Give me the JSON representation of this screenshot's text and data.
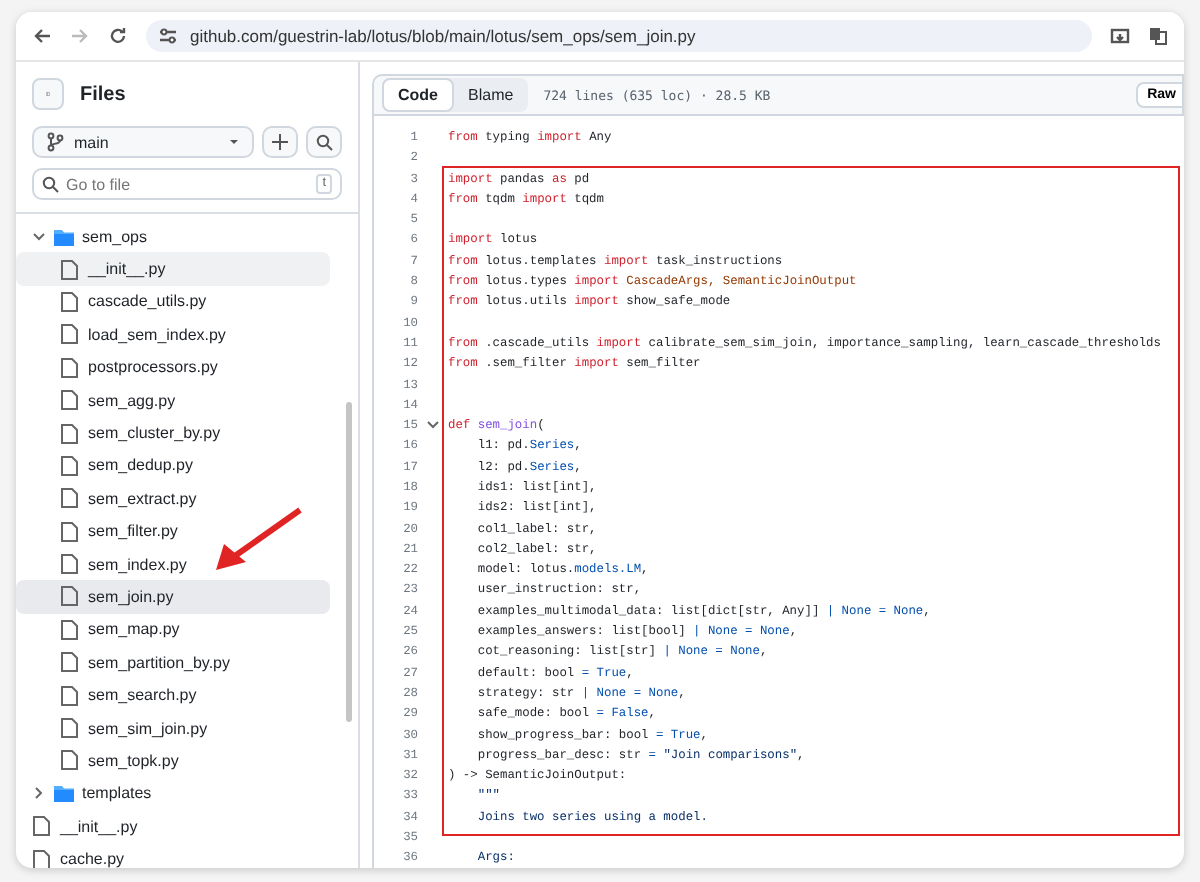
{
  "browser": {
    "url": "github.com/guestrin-lab/lotus/blob/main/lotus/sem_ops/sem_join.py"
  },
  "sidebar": {
    "title": "Files",
    "branch": "main",
    "search": {
      "placeholder": "Go to file",
      "shortcut": "t"
    },
    "tree": [
      {
        "name": "sem_ops",
        "kind": "folder",
        "expanded": true,
        "selected": false,
        "hovered": false,
        "children": [
          {
            "name": "__init__.py",
            "kind": "file",
            "selected": false,
            "hovered": true
          },
          {
            "name": "cascade_utils.py",
            "kind": "file",
            "selected": false,
            "hovered": false
          },
          {
            "name": "load_sem_index.py",
            "kind": "file",
            "selected": false,
            "hovered": false
          },
          {
            "name": "postprocessors.py",
            "kind": "file",
            "selected": false,
            "hovered": false
          },
          {
            "name": "sem_agg.py",
            "kind": "file",
            "selected": false,
            "hovered": false
          },
          {
            "name": "sem_cluster_by.py",
            "kind": "file",
            "selected": false,
            "hovered": false
          },
          {
            "name": "sem_dedup.py",
            "kind": "file",
            "selected": false,
            "hovered": false
          },
          {
            "name": "sem_extract.py",
            "kind": "file",
            "selected": false,
            "hovered": false
          },
          {
            "name": "sem_filter.py",
            "kind": "file",
            "selected": false,
            "hovered": false
          },
          {
            "name": "sem_index.py",
            "kind": "file",
            "selected": false,
            "hovered": false
          },
          {
            "name": "sem_join.py",
            "kind": "file",
            "selected": true,
            "hovered": false
          },
          {
            "name": "sem_map.py",
            "kind": "file",
            "selected": false,
            "hovered": false
          },
          {
            "name": "sem_partition_by.py",
            "kind": "file",
            "selected": false,
            "hovered": false
          },
          {
            "name": "sem_search.py",
            "kind": "file",
            "selected": false,
            "hovered": false
          },
          {
            "name": "sem_sim_join.py",
            "kind": "file",
            "selected": false,
            "hovered": false
          },
          {
            "name": "sem_topk.py",
            "kind": "file",
            "selected": false,
            "hovered": false
          }
        ]
      },
      {
        "name": "templates",
        "kind": "folder",
        "expanded": false,
        "selected": false,
        "hovered": false
      },
      {
        "name": "__init__.py",
        "kind": "file",
        "selected": false,
        "hovered": false
      },
      {
        "name": "cache.py",
        "kind": "file",
        "selected": false,
        "hovered": false
      }
    ]
  },
  "code": {
    "tabs": [
      {
        "label": "Code",
        "selected": true
      },
      {
        "label": "Blame",
        "selected": false
      }
    ],
    "info": "724 lines (635 loc) · 28.5 KB",
    "raw_button": "Raw",
    "lines": [
      {
        "n": "1",
        "tokens": [
          {
            "kind": "kw",
            "text": "from"
          },
          {
            "kind": "tx",
            "text": " typing "
          },
          {
            "kind": "kw",
            "text": "import"
          },
          {
            "kind": "tx",
            "text": " Any"
          }
        ]
      },
      {
        "n": "2"
      },
      {
        "n": "3",
        "tokens": [
          {
            "kind": "kw",
            "text": "import"
          },
          {
            "kind": "tx",
            "text": " pandas "
          },
          {
            "kind": "kw",
            "text": "as"
          },
          {
            "kind": "tx",
            "text": " pd"
          }
        ]
      },
      {
        "n": "4",
        "tokens": [
          {
            "kind": "kw",
            "text": "from"
          },
          {
            "kind": "tx",
            "text": " tqdm "
          },
          {
            "kind": "kw",
            "text": "import"
          },
          {
            "kind": "tx",
            "text": " tqdm"
          }
        ]
      },
      {
        "n": "5"
      },
      {
        "n": "6",
        "tokens": [
          {
            "kind": "kw",
            "text": "import"
          },
          {
            "kind": "tx",
            "text": " lotus"
          }
        ]
      },
      {
        "n": "7",
        "tokens": [
          {
            "kind": "kw",
            "text": "from"
          },
          {
            "kind": "tx",
            "text": " lotus.templates "
          },
          {
            "kind": "kw",
            "text": "import"
          },
          {
            "kind": "tx",
            "text": " task_instructions"
          }
        ]
      },
      {
        "n": "8",
        "tokens": [
          {
            "kind": "kw",
            "text": "from"
          },
          {
            "kind": "tx",
            "text": " lotus.types "
          },
          {
            "kind": "kw",
            "text": "import"
          },
          {
            "kind": "cls",
            "text": " CascadeArgs, SemanticJoinOutput"
          }
        ]
      },
      {
        "n": "9",
        "tokens": [
          {
            "kind": "kw",
            "text": "from"
          },
          {
            "kind": "tx",
            "text": " lotus.utils "
          },
          {
            "kind": "kw",
            "text": "import"
          },
          {
            "kind": "tx",
            "text": " show_safe_mode"
          }
        ]
      },
      {
        "n": "10"
      },
      {
        "n": "11",
        "tokens": [
          {
            "kind": "kw",
            "text": "from"
          },
          {
            "kind": "tx",
            "text": " .cascade_utils "
          },
          {
            "kind": "kw",
            "text": "import"
          },
          {
            "kind": "tx",
            "text": " calibrate_sem_sim_join, importance_sampling, learn_cascade_thresholds"
          }
        ]
      },
      {
        "n": "12",
        "tokens": [
          {
            "kind": "kw",
            "text": "from"
          },
          {
            "kind": "tx",
            "text": " .sem_filter "
          },
          {
            "kind": "kw",
            "text": "import"
          },
          {
            "kind": "tx",
            "text": " sem_filter"
          }
        ]
      },
      {
        "n": "13"
      },
      {
        "n": "14"
      },
      {
        "n": "15",
        "foldable": true,
        "tokens": [
          {
            "kind": "kw",
            "text": "def"
          },
          {
            "kind": "fn",
            "text": " sem_join"
          },
          {
            "kind": "tx",
            "text": "("
          }
        ]
      },
      {
        "n": "16",
        "tokens": [
          {
            "kind": "tx",
            "text": "    l1: pd."
          },
          {
            "kind": "bl",
            "text": "Series"
          },
          {
            "kind": "tx",
            "text": ","
          }
        ]
      },
      {
        "n": "17",
        "tokens": [
          {
            "kind": "tx",
            "text": "    l2: pd."
          },
          {
            "kind": "bl",
            "text": "Series"
          },
          {
            "kind": "tx",
            "text": ","
          }
        ]
      },
      {
        "n": "18",
        "tokens": [
          {
            "kind": "tx",
            "text": "    ids1: list[int],"
          }
        ]
      },
      {
        "n": "19",
        "tokens": [
          {
            "kind": "tx",
            "text": "    ids2: list[int],"
          }
        ]
      },
      {
        "n": "20",
        "tokens": [
          {
            "kind": "tx",
            "text": "    col1_label: str,"
          }
        ]
      },
      {
        "n": "21",
        "tokens": [
          {
            "kind": "tx",
            "text": "    col2_label: str,"
          }
        ]
      },
      {
        "n": "22",
        "tokens": [
          {
            "kind": "tx",
            "text": "    model: lotus."
          },
          {
            "kind": "bl",
            "text": "models.LM"
          },
          {
            "kind": "tx",
            "text": ","
          }
        ]
      },
      {
        "n": "23",
        "tokens": [
          {
            "kind": "tx",
            "text": "    user_instruction: str,"
          }
        ]
      },
      {
        "n": "24",
        "tokens": [
          {
            "kind": "tx",
            "text": "    examples_multimodal_data: list[dict[str, Any]] "
          },
          {
            "kind": "bl",
            "text": "| None = None"
          },
          {
            "kind": "tx",
            "text": ","
          }
        ]
      },
      {
        "n": "25",
        "tokens": [
          {
            "kind": "tx",
            "text": "    examples_answers: list[bool] "
          },
          {
            "kind": "bl",
            "text": "| None = None"
          },
          {
            "kind": "tx",
            "text": ","
          }
        ]
      },
      {
        "n": "26",
        "tokens": [
          {
            "kind": "tx",
            "text": "    cot_reasoning: list[str] "
          },
          {
            "kind": "bl",
            "text": "| None = None"
          },
          {
            "kind": "tx",
            "text": ","
          }
        ]
      },
      {
        "n": "27",
        "tokens": [
          {
            "kind": "tx",
            "text": "    default: bool "
          },
          {
            "kind": "bl",
            "text": "= True"
          },
          {
            "kind": "tx",
            "text": ","
          }
        ]
      },
      {
        "n": "28",
        "tokens": [
          {
            "kind": "tx",
            "text": "    strategy: str "
          },
          {
            "kind": "bl",
            "text": "| None = None"
          },
          {
            "kind": "tx",
            "text": ","
          }
        ]
      },
      {
        "n": "29",
        "tokens": [
          {
            "kind": "tx",
            "text": "    safe_mode: bool "
          },
          {
            "kind": "bl",
            "text": "= False"
          },
          {
            "kind": "tx",
            "text": ","
          }
        ]
      },
      {
        "n": "30",
        "tokens": [
          {
            "kind": "tx",
            "text": "    show_progress_bar: bool "
          },
          {
            "kind": "bl",
            "text": "= True"
          },
          {
            "kind": "tx",
            "text": ","
          }
        ]
      },
      {
        "n": "31",
        "tokens": [
          {
            "kind": "tx",
            "text": "    progress_bar_desc: str "
          },
          {
            "kind": "bl",
            "text": "="
          },
          {
            "kind": "str",
            "text": " \"Join comparisons\""
          },
          {
            "kind": "tx",
            "text": ","
          }
        ]
      },
      {
        "n": "32",
        "tokens": [
          {
            "kind": "tx",
            "text": ") -> SemanticJoinOutput:"
          }
        ]
      },
      {
        "n": "33",
        "tokens": [
          {
            "kind": "str",
            "text": "    \"\"\""
          }
        ]
      },
      {
        "n": "34",
        "tokens": [
          {
            "kind": "str",
            "text": "    Joins two series using a model."
          }
        ]
      },
      {
        "n": "35"
      },
      {
        "n": "36",
        "tokens": [
          {
            "kind": "str",
            "text": "    Args:"
          }
        ]
      }
    ]
  }
}
